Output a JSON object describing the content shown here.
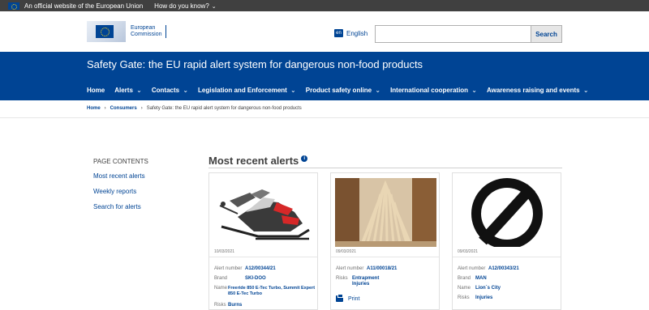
{
  "eu_bar": {
    "official_text": "An official website of the European Union",
    "how_text": "How do you know?"
  },
  "header": {
    "logo_line1": "European",
    "logo_line2": "Commission",
    "language_code": "en",
    "language": "English",
    "search_placeholder": "",
    "search_button": "Search"
  },
  "site_title": "Safety Gate: the EU rapid alert system for dangerous non-food products",
  "nav": [
    {
      "label": "Home",
      "dropdown": false
    },
    {
      "label": "Alerts",
      "dropdown": true
    },
    {
      "label": "Contacts",
      "dropdown": true
    },
    {
      "label": "Legislation and Enforcement",
      "dropdown": true
    },
    {
      "label": "Product safety online",
      "dropdown": true
    },
    {
      "label": "International cooperation",
      "dropdown": true
    },
    {
      "label": "Awareness raising and events",
      "dropdown": true
    }
  ],
  "breadcrumb": {
    "home": "Home",
    "consumers": "Consumers",
    "current": "Safety Gate: the EU rapid alert system for dangerous non-food products"
  },
  "sidebar": {
    "heading": "PAGE CONTENTS",
    "links": [
      "Most recent alerts",
      "Weekly reports",
      "Search for alerts"
    ]
  },
  "main": {
    "title": "Most recent alerts"
  },
  "labels": {
    "alert_number": "Alert number",
    "brand": "Brand",
    "name": "Name",
    "risks": "Risks",
    "print": "Print"
  },
  "cards": [
    {
      "date": "10/03/2021",
      "alert_number": "A12/00344/21",
      "brand": "SKI-DOO",
      "name": "Freeride 850 E-Tec Turbo, Summit Expert 850 E-Tec Turbo",
      "risks": "Burns",
      "image": "snowmobile"
    },
    {
      "date": "09/03/2021",
      "alert_number": "A11/00018/21",
      "risks": "Entrapment Injuries",
      "image": "wooden-triangle"
    },
    {
      "date": "09/03/2021",
      "alert_number": "A12/00343/21",
      "brand": "MAN",
      "name": "Lion´s City",
      "risks": "Injuries",
      "image": "no-image-symbol"
    }
  ],
  "colors": {
    "eu_blue": "#004494",
    "dark_bar": "#404040"
  }
}
